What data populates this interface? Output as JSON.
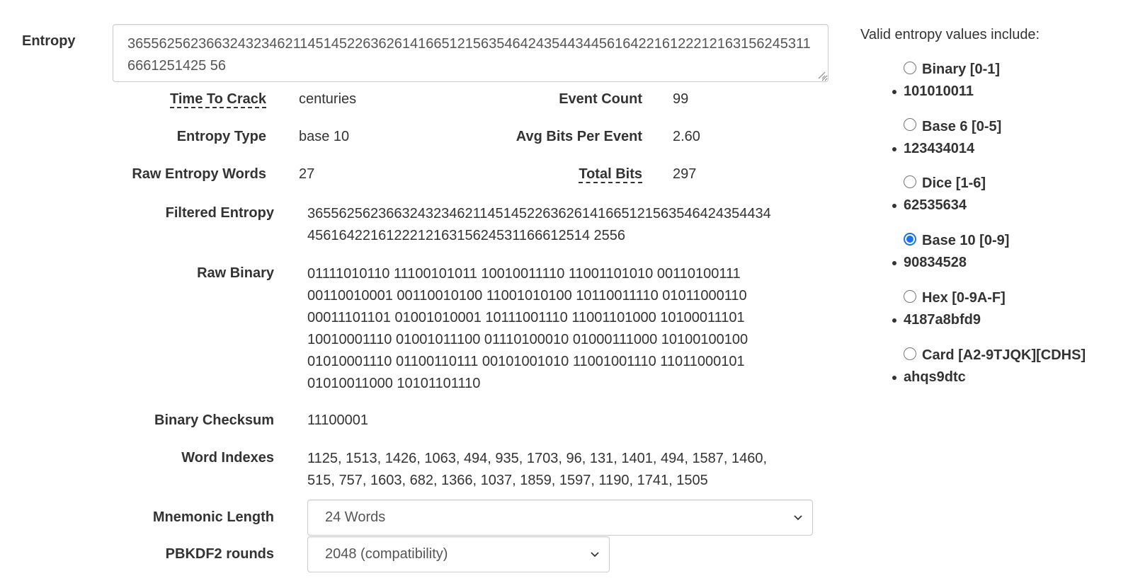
{
  "entropy": {
    "label": "Entropy",
    "value": "3655625623663243234621145145226362614166512156354642435443445616422161222121631562453116661251425 56"
  },
  "stats": {
    "time_to_crack_label": "Time To Crack",
    "time_to_crack": "centuries",
    "event_count_label": "Event Count",
    "event_count": "99",
    "entropy_type_label": "Entropy Type",
    "entropy_type": "base 10",
    "avg_bits_label": "Avg Bits Per Event",
    "avg_bits": "2.60",
    "raw_words_label": "Raw Entropy Words",
    "raw_words": "27",
    "total_bits_label": "Total Bits",
    "total_bits": "297"
  },
  "filtered": {
    "label": "Filtered Entropy",
    "line1": "36556256236632432346211451452263626141665121563546424354434",
    "line2": "456164221612221216315624531166612514 2556"
  },
  "raw_binary": {
    "label": "Raw Binary",
    "lines": [
      "01111010110 11100101011 10010011110 11001101010 00110100111",
      "00110010001 00110010100 11001010100 10110011110 01011000110",
      "00011101101 01001010001 10111001110 11001101000 10100011101",
      "10010001110 01001011100 01110100010 01000111000 10100100100",
      "01010001110 01100110111 00101001010 11001001110 11011000101",
      "01010011000 10101101110"
    ]
  },
  "checksum": {
    "label": "Binary Checksum",
    "value": "11100001"
  },
  "word_indexes": {
    "label": "Word Indexes",
    "line1": "1125, 1513, 1426, 1063, 494, 935, 1703, 96, 131, 1401, 494, 1587, 1460,",
    "line2": "515, 757, 1603, 682, 1366, 1037, 1859, 1597, 1190, 1741, 1505"
  },
  "mnemonic_length": {
    "label": "Mnemonic Length",
    "selected": "24 Words"
  },
  "pbkdf2": {
    "label": "PBKDF2 rounds",
    "selected": "2048 (compatibility)"
  },
  "valid": {
    "title": "Valid entropy values include:",
    "options": [
      {
        "label": "Binary [0-1]",
        "example": "101010011",
        "checked": false
      },
      {
        "label": "Base 6 [0-5]",
        "example": "123434014",
        "checked": false
      },
      {
        "label": "Dice [1-6]",
        "example": "62535634",
        "checked": false
      },
      {
        "label": "Base 10 [0-9]",
        "example": "90834528",
        "checked": true
      },
      {
        "label": "Hex [0-9A-F]",
        "example": "4187a8bfd9",
        "checked": false
      },
      {
        "label": "Card [A2-9TJQK][CDHS]",
        "example": "ahqs9dtc",
        "checked": false
      }
    ]
  },
  "colors": {
    "accent": "#1a73e8",
    "text": "#333333",
    "border": "#cccccc"
  }
}
